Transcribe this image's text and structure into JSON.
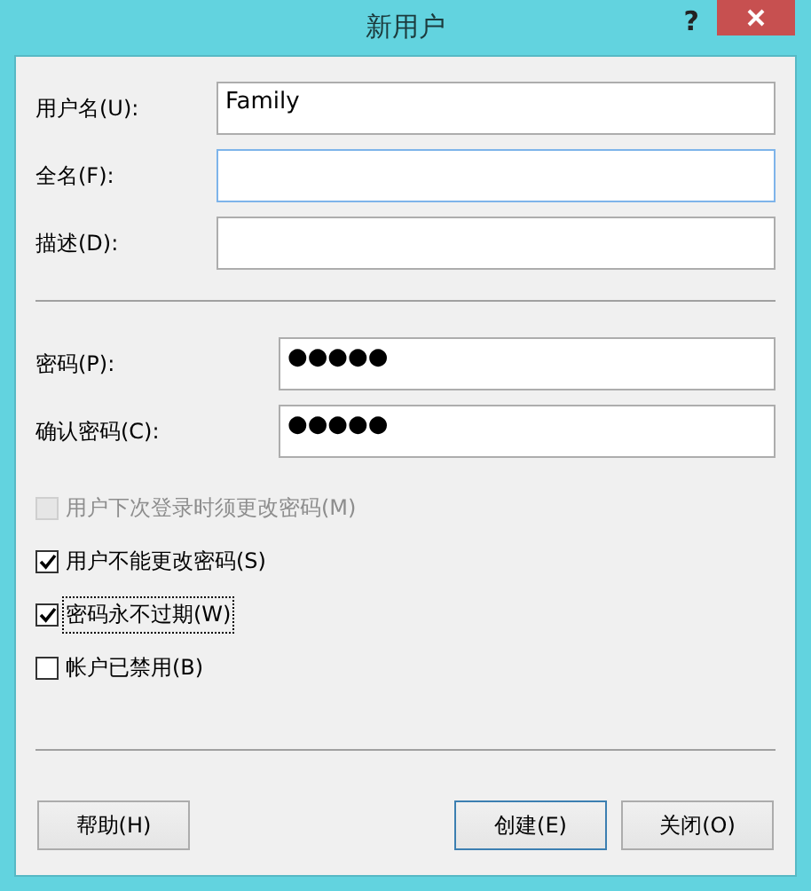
{
  "window": {
    "title": "新用户",
    "help": "?"
  },
  "account_fields": [
    {
      "label": "用户名(U):",
      "value": "Family",
      "focused": false
    },
    {
      "label": "全名(F):",
      "focused": true
    },
    {
      "label": "描述(D):",
      "focused": false
    }
  ],
  "password_fields": [
    {
      "label": "密码(P):",
      "value": "●●●●●",
      "focused": false
    },
    {
      "label": "确认密码(C):",
      "value": "●●●●●",
      "focused": false
    }
  ],
  "options": [
    {
      "label": "用户下次登录时须更改密码(M)",
      "checked": false,
      "disabled": true,
      "focused": false
    },
    {
      "label": "用户不能更改密码(S)",
      "checked": true,
      "disabled": false,
      "focused": false
    },
    {
      "label": "密码永不过期(W)",
      "checked": true,
      "disabled": false,
      "focused": true
    },
    {
      "label": "帐户已禁用(B)",
      "checked": false,
      "disabled": false,
      "focused": false
    }
  ],
  "buttons": [
    {
      "label": "帮助(H)",
      "focused": false
    },
    {
      "label": "创建(E)",
      "focused": true
    },
    {
      "label": "关闭(O)",
      "focused": false
    }
  ]
}
